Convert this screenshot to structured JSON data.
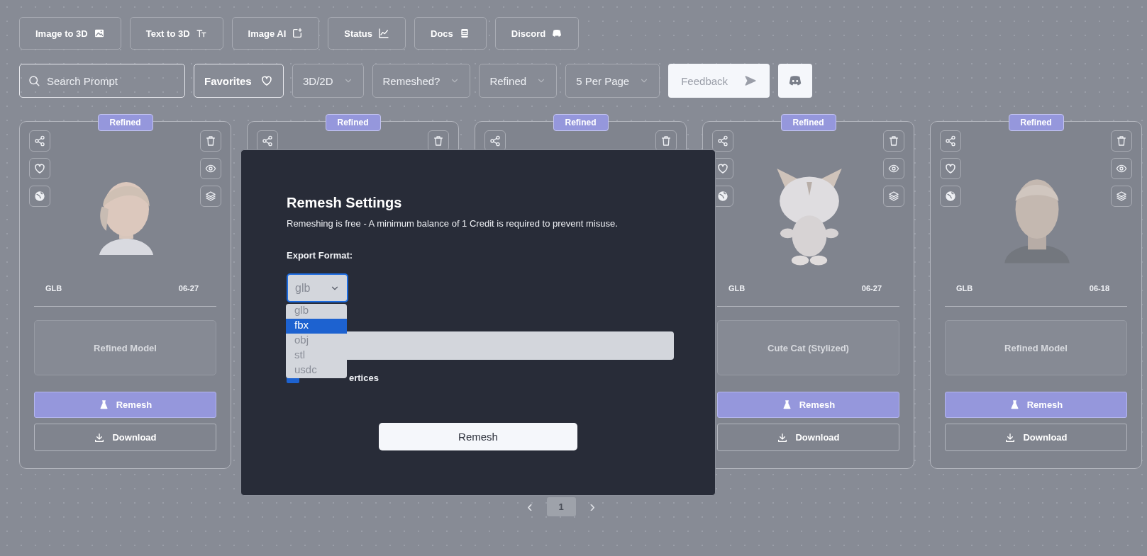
{
  "nav": [
    {
      "label": "Image to 3D"
    },
    {
      "label": "Text to 3D"
    },
    {
      "label": "Image AI"
    },
    {
      "label": "Status"
    },
    {
      "label": "Docs"
    },
    {
      "label": "Discord"
    }
  ],
  "filters": {
    "search": {
      "placeholder": "Search Prompt"
    },
    "favorites": {
      "label": "Favorites"
    },
    "dropdowns": [
      {
        "label": "3D/2D"
      },
      {
        "label": "Remeshed?"
      },
      {
        "label": "Refined"
      },
      {
        "label": "5 Per Page"
      }
    ],
    "feedback": {
      "label": "Feedback"
    }
  },
  "cards": [
    {
      "badge": "Refined",
      "format": "GLB",
      "date": "06-27",
      "title": "Refined Model",
      "remesh": "Remesh",
      "download": "Download"
    },
    {
      "badge": "Refined"
    },
    {
      "badge": "Refined"
    },
    {
      "badge": "Refined",
      "format": "GLB",
      "date": "06-27",
      "title": "Cute Cat (Stylized)",
      "remesh": "Remesh",
      "download": "Download"
    },
    {
      "badge": "Refined",
      "format": "GLB",
      "date": "06-18",
      "title": "Refined Model",
      "remesh": "Remesh",
      "download": "Download"
    }
  ],
  "pagination": {
    "previous": "‹",
    "next": "›",
    "pages": [
      {
        "label": "1",
        "selected": true
      }
    ]
  },
  "modal": {
    "title": "Remesh Settings",
    "description": "Remeshing is free - A minimum balance of 1 Credit is required to prevent misuse.",
    "format_label": "Export Format:",
    "format_value": "glb",
    "format_options": [
      {
        "label": "glb",
        "selected": false
      },
      {
        "label": "fbx",
        "selected": true
      },
      {
        "label": "obj",
        "selected": false
      },
      {
        "label": "stl",
        "selected": false
      },
      {
        "label": "usdc",
        "selected": false
      }
    ],
    "checkbox": {
      "label": "ertices",
      "checked": true
    },
    "submit": "Remesh"
  }
}
